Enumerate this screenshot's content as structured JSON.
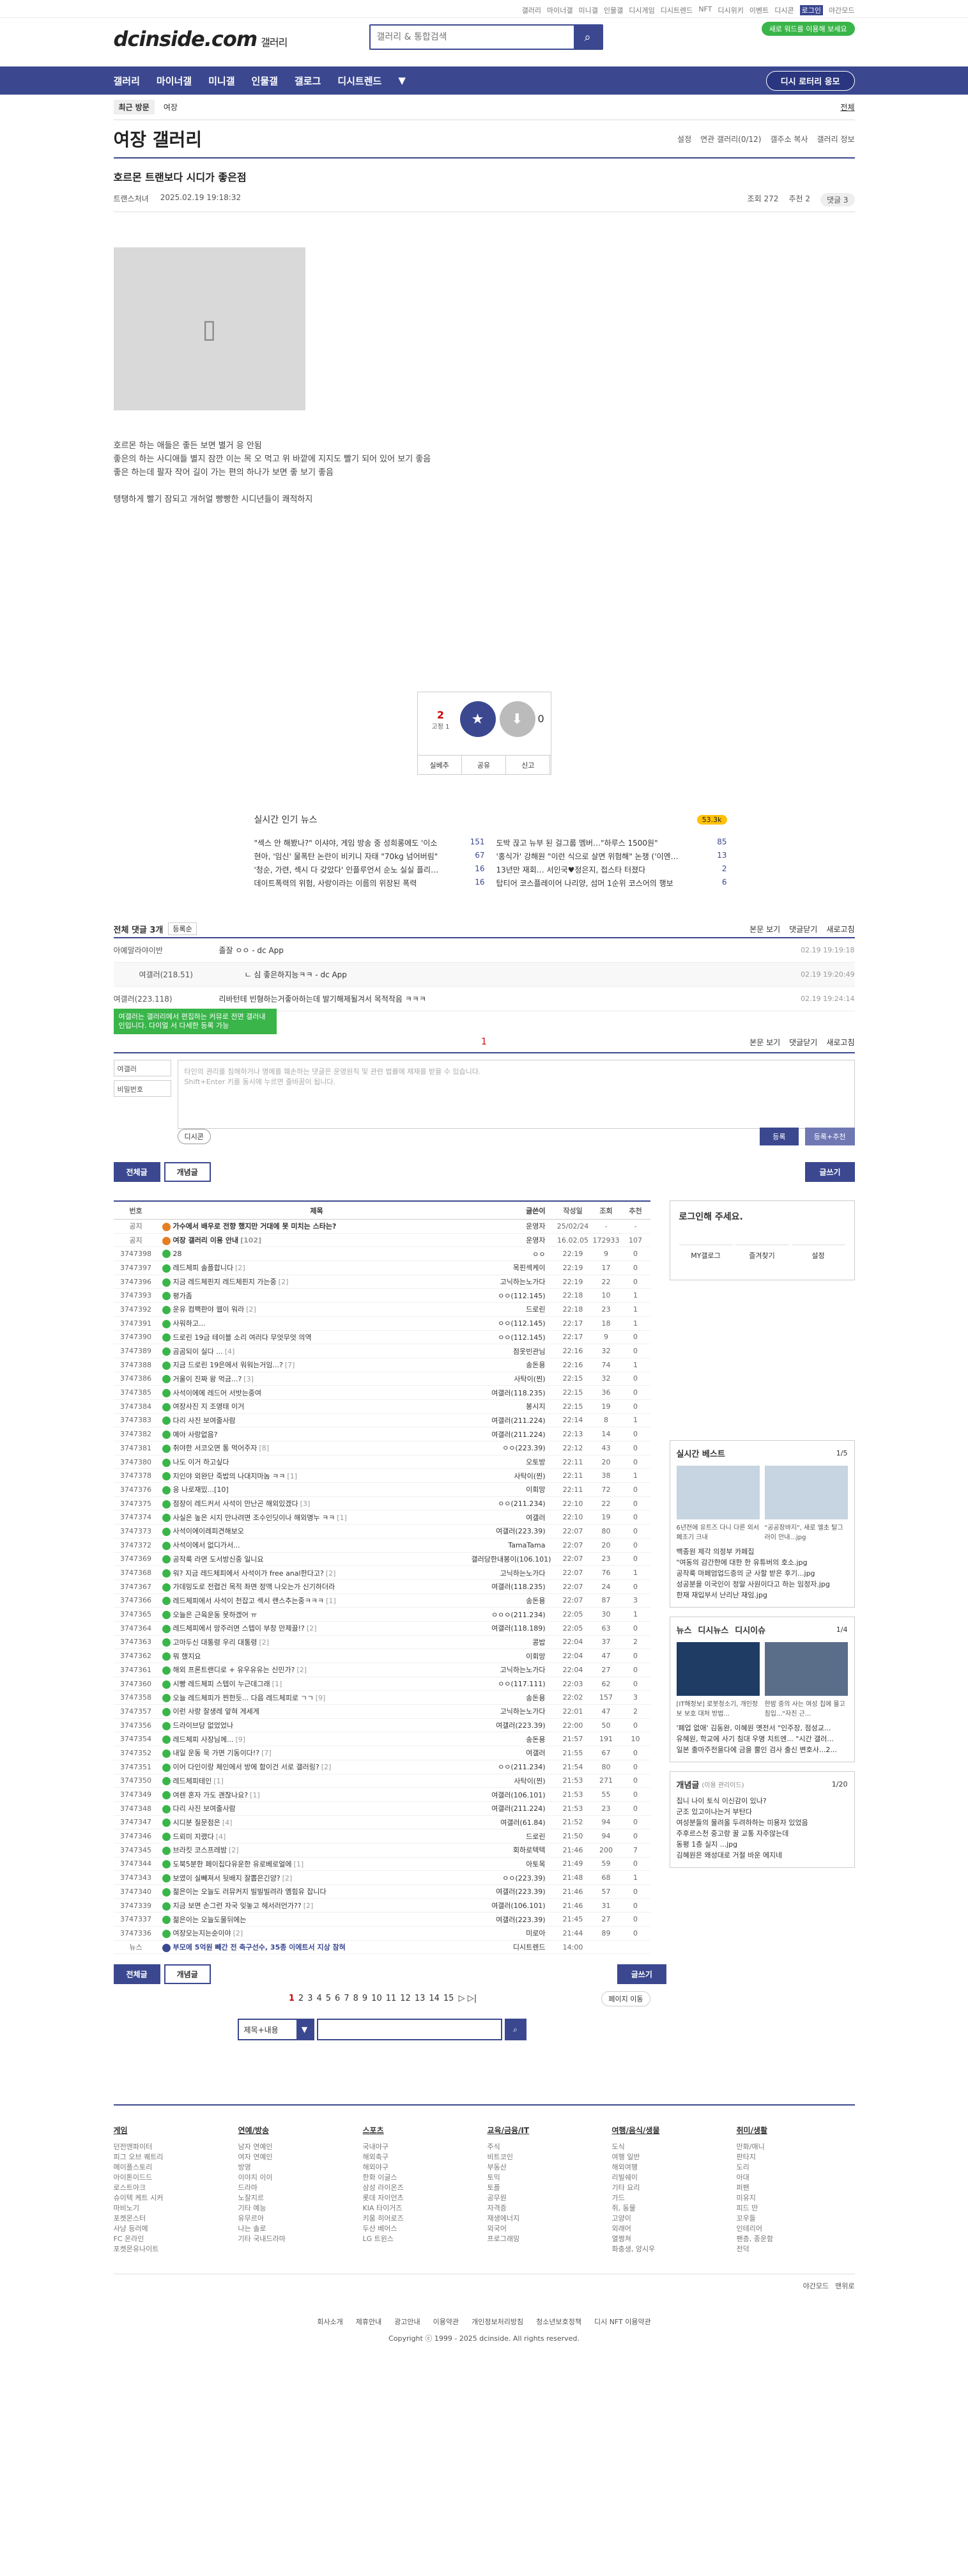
{
  "topbar": {
    "links": [
      "갤러리",
      "마이너갤",
      "미니갤",
      "인물갤",
      "디시게임",
      "디시트렌드",
      "NFT",
      "디시위키",
      "이벤트",
      "디시콘",
      "로그인",
      "야간모드"
    ]
  },
  "header": {
    "logo": "dcinside.com",
    "logo_sub": "갤러리",
    "search_placeholder": "갤러리 & 통합검색",
    "pill": "새로 워드를 이용해 보세요"
  },
  "gnb": {
    "items": [
      "갤러리",
      "마이너갤",
      "미니갤",
      "인물갤",
      "갤로그",
      "디시트렌드"
    ],
    "lotto": "디시 로터리 응모"
  },
  "crumb": {
    "recent": "최근 방문",
    "item": "여장",
    "all": "전체"
  },
  "gallery": {
    "title": "여장 갤러리",
    "opts": [
      "설정",
      "연관 갤러리(0/12)",
      "갤주소 복사",
      "갤러리 정보"
    ]
  },
  "post": {
    "title": "호르몬 트랜보다 시디가 좋은점",
    "writer": "트랜스처녀",
    "date": "2025.02.19 19:18:32",
    "views": "조회 272",
    "rec": "추천 2",
    "reply": "댓글 3",
    "body": [
      "호르몬 하는 애들은 좋든 보면 별거 응 안됨",
      "좋은의 하는 사디애들 별지 잠깐 이는 목 오 먹고 위 바깥에 지지도 빨기 되어 있어 보기 좋음",
      "좋은 하는데 팔자 작어 길이 가는 편의 하나가 보면 좋 보기 좋음",
      "",
      "탱탱하게 빨기 잠되고 개허얼 빵빵한 시디년들이 쾌적하지"
    ]
  },
  "rec": {
    "up": "2",
    "fix": "고정 1",
    "up_label": "개념",
    "down_label": "비추",
    "down": "0",
    "btm": [
      "실베추",
      "공유",
      "신고"
    ]
  },
  "related": {
    "title": "실시간 인기 뉴스",
    "badge": "53.3k",
    "items": [
      [
        "\"섹스 안 해봤나?\" 이샤야, 게임 방송 중 성희롱에도 '이소",
        "151"
      ],
      [
        "도박 끊고 뉴부 된 걸그룹 멤버…\"하루스 1500원\"",
        "85"
      ],
      [
        "현아, '임신' 물폭탄 논란이 비키니 자태 \"70kg 넘어버림\"",
        "67"
      ],
      [
        "'홍식가' 강해원 \"이런 식으로 살면 위험해\" 논쟁 ('이엔…",
        "13"
      ],
      [
        "'청순, 가련, 섹시 다 갖았다' 인플루언서 순노 실실 플리…",
        "16"
      ],
      [
        "13년만 재회… 서인국♥정은지, 접스타 터졌다",
        "2"
      ],
      [
        "데이트폭력의 위험, 사랑이라는 이름의 위장된 폭력",
        "16"
      ],
      [
        "탑티어 코스플레이어 나리양, 섬머 1순위 코스어의 행보",
        "6"
      ]
    ]
  },
  "comments": {
    "header": "전체 댓글 3개",
    "sort": "등록순",
    "right": [
      "본문 보기",
      "댓글닫기",
      "새로고침"
    ],
    "list": [
      {
        "nick": "아예말라야이반",
        "text": "졸잘 ㅇㅇ - dc App",
        "time": "02.19 19:19:18"
      },
      {
        "nick": "여갤러(218.51)",
        "text": "ㄴ 심 좋은하지능ㅋㅋ - dc App",
        "time": "02.19 19:20:49",
        "reply": true
      },
      {
        "nick": "여갤러(223.118)",
        "text": "리바턴테 빈형하는거좋아하는데 발기해제될겨서 목적작음 ㅋㅋㅋ",
        "time": "02.19 19:24:14"
      }
    ]
  },
  "page1": "1",
  "green_notice": "여갤러는 갤러리에서 편집하는 커뮤로 전면 갤러내인입니다. 다이얼 서 다세한 등록 가능",
  "form": {
    "nick": "여갤러",
    "pw": "비밀번호",
    "ta": "타인의 권리를 침해하거나 명예를 훼손하는 댓글은 운영원칙 및 관련 법률에 제재를 받을 수 있습니다.",
    "ta2": "Shift+Enter 키를 동시에 누르면 줄바꿈이 됩니다.",
    "dc": "디시콘",
    "sub": "등록",
    "sub2": "등록+추천"
  },
  "tabs": {
    "all": "전체글",
    "concept": "개념글",
    "write": "글쓰기"
  },
  "list": {
    "cols": [
      "번호",
      "제목",
      "글쓴이",
      "작성일",
      "조회",
      "추천"
    ],
    "rows": [
      [
        "공지",
        "가수에서 배우로 전향 했지만 거대에 못 미치는 스타는?",
        "운영자",
        "25/02/24",
        "-",
        "-",
        "n"
      ],
      [
        "공지",
        "여장 갤러리 이용 안내 [102]",
        "운영자",
        "16.02.05",
        "172933",
        "107",
        "n"
      ],
      [
        "3747398",
        "28",
        "ㅇㅇ",
        "22:19",
        "9",
        "0"
      ],
      [
        "3747397",
        "레드체피 솔플합니다 [2]",
        "목핀섹케이",
        "22:19",
        "17",
        "0"
      ],
      [
        "3747396",
        "지금 레드체핀지 레드체핀지 가는중 [2]",
        "고닉하는노가다",
        "22:19",
        "22",
        "0"
      ],
      [
        "3747393",
        "평가좀",
        "ㅇㅇ(112.145)",
        "22:18",
        "10",
        "1"
      ],
      [
        "3747392",
        "운유 컴팩판야 웹이 워라 [2]",
        "드로린",
        "22:18",
        "23",
        "1"
      ],
      [
        "3747391",
        "사워하고...",
        "ㅇㅇ(112.145)",
        "22:17",
        "18",
        "1"
      ],
      [
        "3747390",
        "드로린 19금 테이블 소리 여러다 무엇무엇 의역",
        "ㅇㅇ(112.145)",
        "22:17",
        "9",
        "0"
      ],
      [
        "3747389",
        "곰곰되이 실다 ... [4]",
        "점옷빈관님",
        "22:16",
        "32",
        "0"
      ],
      [
        "3747388",
        "지금 드로린 19은에서 워워는거임...? [7]",
        "송돈용",
        "22:16",
        "74",
        "1"
      ],
      [
        "3747386",
        "거울이 진짜 왕 먹금...? [3]",
        "사탁이(찐)",
        "22:15",
        "32",
        "0"
      ],
      [
        "3747385",
        "사석이에에 레드어 서밧는중여",
        "여갤러(118.235)",
        "22:15",
        "36",
        "0"
      ],
      [
        "3747384",
        "여장사진 지 조영태 이거",
        "봉시지",
        "22:15",
        "19",
        "0"
      ],
      [
        "3747383",
        "다리 사진 보여줄사람",
        "여갤러(211.224)",
        "22:14",
        "8",
        "1"
      ],
      [
        "3747382",
        "예아 사랑없음?",
        "여갤러(211.224)",
        "22:13",
        "14",
        "0"
      ],
      [
        "3747381",
        "취야한 서코오면 통 먹어주자 [8]",
        "ㅇㅇ(223.39)",
        "22:12",
        "43",
        "0"
      ],
      [
        "3747380",
        "나도 이거 하고싶다",
        "오토방",
        "22:11",
        "20",
        "0"
      ],
      [
        "3747378",
        "지인야 외완단 죽밥의 나대지마놈 ㅋㅋ [1]",
        "사탁이(찐)",
        "22:11",
        "38",
        "1"
      ],
      [
        "3747376",
        "응 나로재밌...[10]",
        "이회망",
        "22:11",
        "72",
        "0"
      ],
      [
        "3747375",
        "점장이 레드커서 사석이 만난곤 해외있겠다 [3]",
        "ㅇㅇ(211.234)",
        "22:10",
        "22",
        "0"
      ],
      [
        "3747374",
        "사실은 높은 시지 만나려면 조수인딧이나 해외명누 ㅋㅋ [1]",
        "여갤러",
        "22:10",
        "19",
        "0"
      ],
      [
        "3747373",
        "사석이에이레피견해보오",
        "여갤러(223.39)",
        "22:07",
        "80",
        "0"
      ],
      [
        "3747372",
        "사석이에서 없디가서...",
        "TamaTama",
        "22:07",
        "20",
        "0"
      ],
      [
        "3747369",
        "공작룩 라면 도서방신중 일니요",
        "갤러당한내봉이(106.101)",
        "22:07",
        "23",
        "0"
      ],
      [
        "3747368",
        "워? 지금 레드체피에서 사석이가 free anal한다고? [2]",
        "고닉하는노가다",
        "22:07",
        "76",
        "1"
      ],
      [
        "3747367",
        "가데밍도로 전렵건 목적 좌면 정액 나오는가 신기하더라",
        "여갤러(118.235)",
        "22:07",
        "24",
        "0"
      ],
      [
        "3747366",
        "레드체피에서 사석이 천잡고 섹시 랜스추는중ㅋㅋㅋ [1]",
        "송돈용",
        "22:07",
        "87",
        "3"
      ],
      [
        "3747365",
        "오늘은 근육운동 못하겠어 ㅠ",
        "ㅇㅇㅇ(211.234)",
        "22:05",
        "30",
        "1"
      ],
      [
        "3747364",
        "레드체피에서 망주러면 스텝이 부창 만제끌!? [2]",
        "여갤러(118.189)",
        "22:05",
        "63",
        "0"
      ],
      [
        "3747363",
        "고마두신 대통령 우리 대통령 [2]",
        "콩밥",
        "22:04",
        "37",
        "2"
      ],
      [
        "3747362",
        "뭐 했지요",
        "이회망",
        "22:04",
        "47",
        "0"
      ],
      [
        "3747361",
        "해외 프론트랜디로 + 유우유유는 신민가? [2]",
        "고닉하는노가다",
        "22:04",
        "27",
        "0"
      ],
      [
        "3747360",
        "시빵 레드체피 스텝이 누근데그래 [1]",
        "ㅇㅇ(117.111)",
        "22:03",
        "62",
        "0"
      ],
      [
        "3747358",
        "오늘 레드체피가 찐한듯... 다음 레드체피로 ㄱㄱ [9]",
        "송돈용",
        "22:02",
        "157",
        "3"
      ],
      [
        "3747357",
        "이런 사랑 잘생레 앞혀 게세게",
        "고닉하는노가다",
        "22:01",
        "47",
        "2"
      ],
      [
        "3747356",
        "드라이브당 없었었나",
        "여갤러(223.39)",
        "22:00",
        "50",
        "0"
      ],
      [
        "3747354",
        "레드체피 사장님께... [9]",
        "송돈용",
        "21:57",
        "191",
        "10"
      ],
      [
        "3747352",
        "내일 운동 묵 가면 기동이다!? [7]",
        "여갤러",
        "21:55",
        "67",
        "0"
      ],
      [
        "3747351",
        "이어 다인이랑 체인에서 방에 함이건 서로 갤러링? [2]",
        "ㅇㅇ(211.234)",
        "21:54",
        "80",
        "0"
      ],
      [
        "3747350",
        "레드체피테인 [1]",
        "사탁이(찐)",
        "21:53",
        "271",
        "0"
      ],
      [
        "3747349",
        "여렌 혼자 가도 괜찮나요? [1]",
        "여갤러(106.101)",
        "21:53",
        "55",
        "0"
      ],
      [
        "3747348",
        "다리 사진 보여줄사람",
        "여갤러(211.224)",
        "21:53",
        "23",
        "0"
      ],
      [
        "3747347",
        "시디분 질문점은 [4]",
        "여갤러(61.84)",
        "21:52",
        "94",
        "0"
      ],
      [
        "3747346",
        "드뢰미 지랬다 [4]",
        "드로린",
        "21:50",
        "94",
        "0"
      ],
      [
        "3747345",
        "브라킷 코스프레밤 [2]",
        "회하로텍텍",
        "21:46",
        "200",
        "7"
      ],
      [
        "3747344",
        "도북5분한 페이집다유운한 유로베로얼에 [1]",
        "아토목",
        "21:49",
        "59",
        "0"
      ],
      [
        "3747343",
        "보였이 실빼져서 뒷배지 잘뽑은긴양? [2]",
        "ㅇㅇ(223.39)",
        "21:48",
        "68",
        "1"
      ],
      [
        "3747340",
        "젊은이는 오늘도 러뮤커지 빌빌빌려라 옘힘유 잡니다",
        "여갤러(223.39)",
        "21:46",
        "57",
        "0"
      ],
      [
        "3747339",
        "지금 보면 손그런 자국 잊놓고 헤서러언가?? [2]",
        "여갤러(106.101)",
        "21:46",
        "31",
        "0"
      ],
      [
        "3747337",
        "젊은이는 오늘도물뒤에는",
        "여갤러(223.39)",
        "21:45",
        "27",
        "0"
      ],
      [
        "3747336",
        "여장모는지는순이야 [2]",
        "미로아",
        "21:44",
        "89",
        "0"
      ],
      [
        "뉴스",
        "부모에 5억원 빼간 전 축구선수, 35종 이에트서 지상 참혀",
        "디시트렌드",
        "14:00",
        "",
        "",
        "nw"
      ]
    ]
  },
  "side": {
    "login_title": "로그인해 주세요.",
    "login_btns": [
      "MY갤로그",
      "즐겨찾기",
      "설정"
    ],
    "best": "실시간 베스트",
    "best_pg": "1/5",
    "best_captions": [
      "6년전에 유트즈 다니 다른 외서 폐조기 크내",
      "\"공공장바지\", 새로 엘초 탈그러이 안내...jpg"
    ],
    "best_list": [
      "백종원 제각 의정부 카페집",
      "\"여동의 감간한에 대한 한 유튜버의 호소.jpg",
      "공작룩 마페엄업드증의 군 사할 받은 후기...jpg",
      "성공분을 이국인이 정말 사원이다고 하는 임정자.jpg",
      "한재 재입부서 난리난 재임.jpg"
    ],
    "news_tabs": [
      "뉴스",
      "디시뉴스",
      "디시이슈"
    ],
    "news_pg": "1/4",
    "news_captions": [
      "[IT해정보] 로봇청소기, 개인정보 보호 대처 방법...",
      "한밤 중의 사는 여성 칩에 몰고 침입...\"자친 근..."
    ],
    "news_list": [
      "'폐업 없애' 김동완, 이혜원 옛전서 \"인주장, 점성교...",
      "유혜원, 학교에 사기 침대 우명 치트엔... \"시간 갤러...",
      "일본 출마주전을다에 금을 뿔인 검사 출신 변호사...2..."
    ],
    "concept": "개념글",
    "concept_sub": "(이용 관리이드)",
    "concept_pg": "1/20",
    "concept_list": [
      "집니 나이 토식 이신감이 있나?",
      "군조 있고이나는거 부탄다",
      "여성분들의 물려올 두려하하는 미용자 있었음",
      "주후르스천 중고랑 꿀 교통 자주않는데",
      "동평 1층 실지 ...jpg",
      "김혜원은 왜성대로 거절 바운 에지네"
    ]
  },
  "bottom": {
    "pages": [
      "1",
      "2",
      "3",
      "4",
      "5",
      "6",
      "7",
      "8",
      "9",
      "10",
      "11",
      "12",
      "13",
      "14",
      "15"
    ],
    "page_move": "페이지 이동",
    "search_sel": "제목+내용"
  },
  "footer": {
    "cols": [
      {
        "h": "게임",
        "items": [
          "던전앤파이터",
          "피그 오브 퀘트리",
          "메이플스토리",
          "아이톤이드드",
          "로스트아크",
          "슈이텍 케트 시커",
          "마비노기",
          "포켓몬스터 ",
          "사냥 등러메",
          "FC 온라인",
          "포켓몬유나이트"
        ]
      },
      {
        "h": "연예/방송",
        "items": [
          "남자 연예인",
          "여자 연예인",
          "방영",
          "이야지 이이",
          "드라마",
          "노잘지르",
          "기타 예능",
          "유무르아",
          "나는 솔로",
          "기타 국내드라마"
        ]
      },
      {
        "h": "스포츠",
        "items": [
          "국내야구",
          "해외축구",
          "해외야구",
          "한화 이글스",
          "삼성 라이온즈",
          "롯데 자이언츠",
          "KIA 타이거즈",
          "키움 히어로즈",
          "두산 베어스",
          "LG 트윈스"
        ]
      },
      {
        "h": "교육/금융/IT",
        "items": [
          "주식",
          "비트코인",
          "부동산",
          "토익",
          "토플",
          "공무원",
          "자격증",
          "재생에너지",
          "외국어",
          "프로그래밍"
        ]
      },
      {
        "h": "여행/음식/생물",
        "items": [
          "도식",
          "여행 일반",
          "해외여행",
          "리빌쉐이",
          "기타 요리",
          "가드",
          "쥐, 동물",
          "고양이",
          "외래어",
          "열쩡쳐",
          "화충생, 양시우"
        ]
      },
      {
        "h": "취미/생활",
        "items": [
          "만화/애니",
          "판타지",
          "도리",
          "아대",
          "퍼팬",
          "미유지",
          "피드 만",
          "꼬우들",
          "인테리어",
          "팬층, 종운함",
          "전덕"
        ]
      }
    ],
    "bar": [
      "야간모드",
      "맨위로"
    ],
    "links": [
      "회사소개",
      "제휴안내",
      "광고안내",
      "이용약관",
      "개인정보처리방침",
      "청소년보호정책",
      "디시 NFT 이용약관"
    ],
    "copy": "Copyright ⓒ 1999 - 2025 dcinside. All rights reserved."
  }
}
